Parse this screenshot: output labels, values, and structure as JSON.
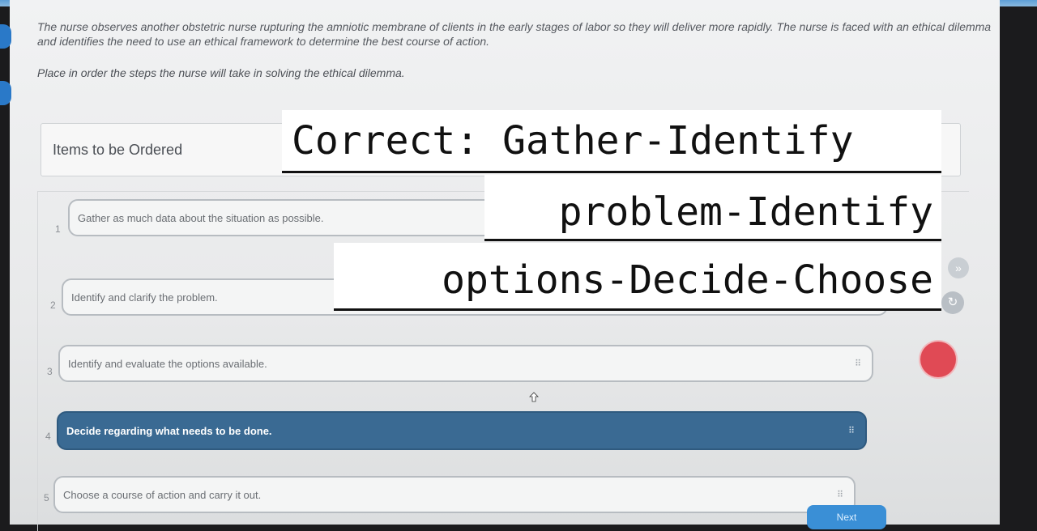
{
  "question": {
    "stem": "The nurse observes another obstetric nurse rupturing the amniotic membrane of clients in the early stages of labor so they will deliver more rapidly. The nurse is faced with an ethical dilemma and identifies the need to use an ethical framework to determine the best course of action.",
    "instruction": "Place in order the steps the nurse will take in solving the ethical dilemma."
  },
  "ordering": {
    "heading": "Items to be Ordered",
    "items": [
      {
        "num": "1",
        "label": "Gather as much data about the situation as possible."
      },
      {
        "num": "2",
        "label": "Identify and clarify the problem."
      },
      {
        "num": "3",
        "label": "Identify and evaluate the options available."
      },
      {
        "num": "4",
        "label": "Decide regarding what needs to be done.",
        "selected": true
      },
      {
        "num": "5",
        "label": "Choose a course of action and carry it out."
      }
    ]
  },
  "navigation": {
    "next_label": "Next"
  },
  "overlay_annotation": {
    "line1": "Correct: Gather-Identify",
    "line2": "problem-Identify",
    "line3": "options-Decide-Choose"
  },
  "colors": {
    "selected_item": "#3a6a93",
    "next_button": "#3a8fd6",
    "record_button": "#e04a55"
  },
  "icons": [
    "drag-handle-icon",
    "pointer-cursor-icon",
    "collapse-icon",
    "refresh-icon",
    "record-icon"
  ]
}
